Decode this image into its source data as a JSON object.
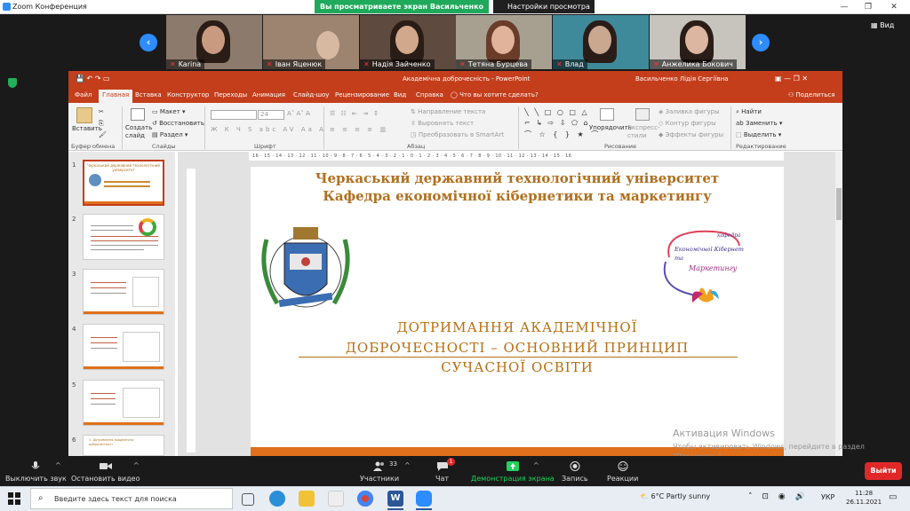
{
  "zoom": {
    "window_title": "Zoom Конференция",
    "view_banner": "Вы просматриваете экран Васильченко Лідія",
    "view_options": "Настройки просмотра",
    "side_video_label": "Вид",
    "participants": [
      {
        "name": "Karina"
      },
      {
        "name": "Іван Яценюк"
      },
      {
        "name": "Надія Зайченко"
      },
      {
        "name": "Тетяна Бурцева"
      },
      {
        "name": "Влад"
      },
      {
        "name": "Анжелика Бокович"
      }
    ],
    "toolbar": {
      "mute": "Выключить звук",
      "video": "Остановить видео",
      "participants": "Участники",
      "participants_count": "33",
      "chat": "Чат",
      "chat_badge": "1",
      "share": "Демонстрация экрана",
      "record": "Запись",
      "reactions": "Реакции",
      "leave": "Выйти"
    }
  },
  "ppt": {
    "doc_title": "Академічна доброчесність  -  PowerPoint",
    "user": "Васильченко Лідія Сергіївна",
    "tabs": [
      "Файл",
      "Главная",
      "Вставка",
      "Конструктор",
      "Переходы",
      "Анимация",
      "Слайд-шоу",
      "Рецензирование",
      "Вид",
      "Справка"
    ],
    "active_tab": "Главная",
    "tell_me": "Что вы хотите сделать?",
    "share": "Поделиться",
    "ribbon": {
      "paste": "Вставить",
      "cut": "Макет",
      "reset": "Восстановить",
      "section": "Раздел",
      "new_slide": "Создать слайд",
      "font_size": "24",
      "text_direction": "Направление текста",
      "align_text": "Выровнять текст",
      "smartart": "Преобразовать в SmartArt",
      "arrange": "Упорядочить",
      "quick_styles": "Экспресс-стили",
      "shape_fill": "Заливка фигуры",
      "shape_outline": "Контур фигуры",
      "shape_effects": "Эффекты фигуры",
      "find": "Найти",
      "replace": "Заменить",
      "select": "Выделить",
      "groups": [
        "Буфер обмена",
        "Слайды",
        "Шрифт",
        "Абзац",
        "Рисование",
        "Редактирование"
      ]
    },
    "thumbnails": [
      {
        "num": "1",
        "text": "Черкаський державний технологічний університет"
      },
      {
        "num": "2",
        "text": ""
      },
      {
        "num": "3",
        "text": ""
      },
      {
        "num": "4",
        "text": ""
      },
      {
        "num": "5",
        "text": ""
      },
      {
        "num": "6",
        "text": "1. Дотримання академічної доброчесності"
      }
    ],
    "ruler": "16 · 15 · 14 · 13 · 12 · 11 · 10 · 9 · 8 · 7 · 6 · 5 · 4 · 3 · 2 · 1 · 0 · 1 · 2 · 3 · 4 · 5 · 6 · 7 · 8 · 9 · 10 · 11 · 12 · 13 · 14 · 15 · 16",
    "slide": {
      "line1": "Черкаський державний технологічний університет",
      "line2": "Кафедра економічної кібернетики та маркетингу",
      "title1": "ДОТРИМАННЯ АКАДЕМІЧНОЇ",
      "title2": "ДОБРОЧЕСНОСТІ – ОСНОВНИЙ ПРИНЦИП",
      "title3": "СУЧАСНОЇ ОСВІТИ",
      "kafedra_top": "кафедра",
      "kafedra_1": "Економічної Кібернетики",
      "kafedra_2": "та",
      "kafedra_3": "Маркетингу"
    }
  },
  "activation": {
    "title": "Активация Windows",
    "subtitle": "Чтобы активировать Windows, перейдите в раздел \"Параметры\"."
  },
  "taskbar": {
    "search_placeholder": "Введите здесь текст для поиска",
    "weather": "6°C  Partly sunny",
    "lang": "УКР",
    "time": "11:28",
    "date": "26.11.2021"
  }
}
